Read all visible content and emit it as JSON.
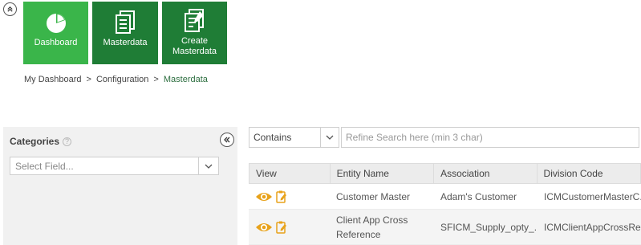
{
  "tiles": [
    {
      "label": "Dashboard",
      "icon": "pie-chart-icon"
    },
    {
      "label": "Masterdata",
      "icon": "documents-icon"
    },
    {
      "label": "Create Masterdata",
      "icon": "documents-edit-icon"
    }
  ],
  "breadcrumb": {
    "items": [
      "My Dashboard",
      "Configuration",
      "Masterdata"
    ],
    "separator": ">"
  },
  "categories": {
    "title": "Categories",
    "help": "?",
    "select_placeholder": "Select Field..."
  },
  "search": {
    "operator": "Contains",
    "placeholder": "Refine Search here (min 3 char)"
  },
  "table": {
    "columns": [
      "View",
      "Entity Name",
      "Association",
      "Division Code"
    ],
    "rows": [
      {
        "entity": "Customer Master",
        "association": "Adam's Customer",
        "division": "ICMCustomerMasterC..."
      },
      {
        "entity": "Client App Cross Reference",
        "association": "SFICM_Supply_opty_...",
        "division": "ICMClientAppCrossRe..."
      }
    ]
  },
  "colors": {
    "tile_active": "#3ab54a",
    "tile_dark": "#1f7d36",
    "view_icon": "#e8a21a"
  }
}
